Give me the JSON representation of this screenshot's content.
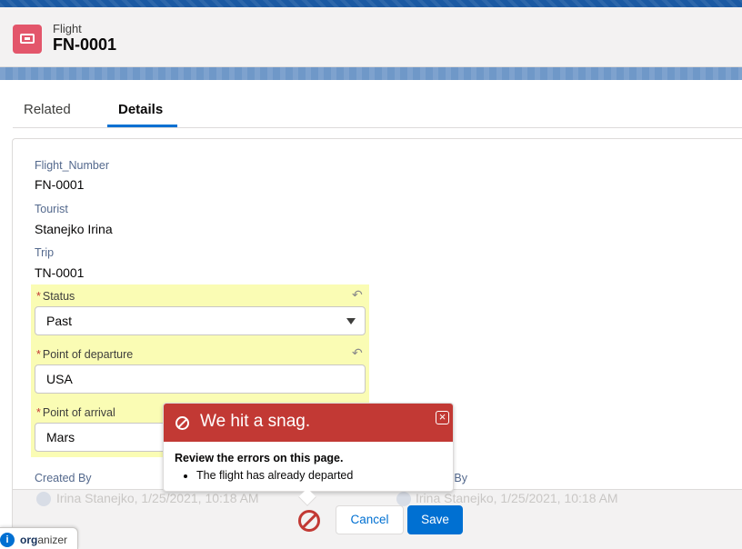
{
  "header": {
    "object_label": "Flight",
    "record_title": "FN-0001",
    "icon": "ticket-icon"
  },
  "tabs": [
    {
      "label": "Related",
      "active": false
    },
    {
      "label": "Details",
      "active": true
    }
  ],
  "fields": {
    "flight_number": {
      "label": "Flight_Number",
      "value": "FN-0001"
    },
    "tourist": {
      "label": "Tourist",
      "value": "Stanejko Irina"
    },
    "trip": {
      "label": "Trip",
      "value": "TN-0001"
    }
  },
  "edited_fields": {
    "required_marker": "*",
    "status": {
      "label": "Status",
      "value": "Past"
    },
    "departure": {
      "label": "Point of departure",
      "value": "USA"
    },
    "arrival": {
      "label": "Point of arrival",
      "value": "Mars"
    }
  },
  "system_fields": {
    "created_by": {
      "label": "Created By",
      "value": "Irina Stanejko, 1/25/2021, 10:18 AM"
    },
    "modified_by": {
      "label_visible": "ed By",
      "value": "Irina Stanejko, 1/25/2021, 10:18 AM"
    }
  },
  "error_popover": {
    "title": "We hit a snag.",
    "heading": "Review the errors on this page.",
    "errors": [
      "The flight has already departed"
    ],
    "close_symbol": "×"
  },
  "footer": {
    "cancel_label": "Cancel",
    "save_label": "Save"
  },
  "organizer": {
    "icon_glyph": "i",
    "brand_bold": "org",
    "brand_rest": "anizer"
  },
  "colors": {
    "brand_blue": "#0070d2",
    "error_red": "#c23934",
    "highlight_yellow": "#fafcb4",
    "object_icon": "#e3566b"
  }
}
